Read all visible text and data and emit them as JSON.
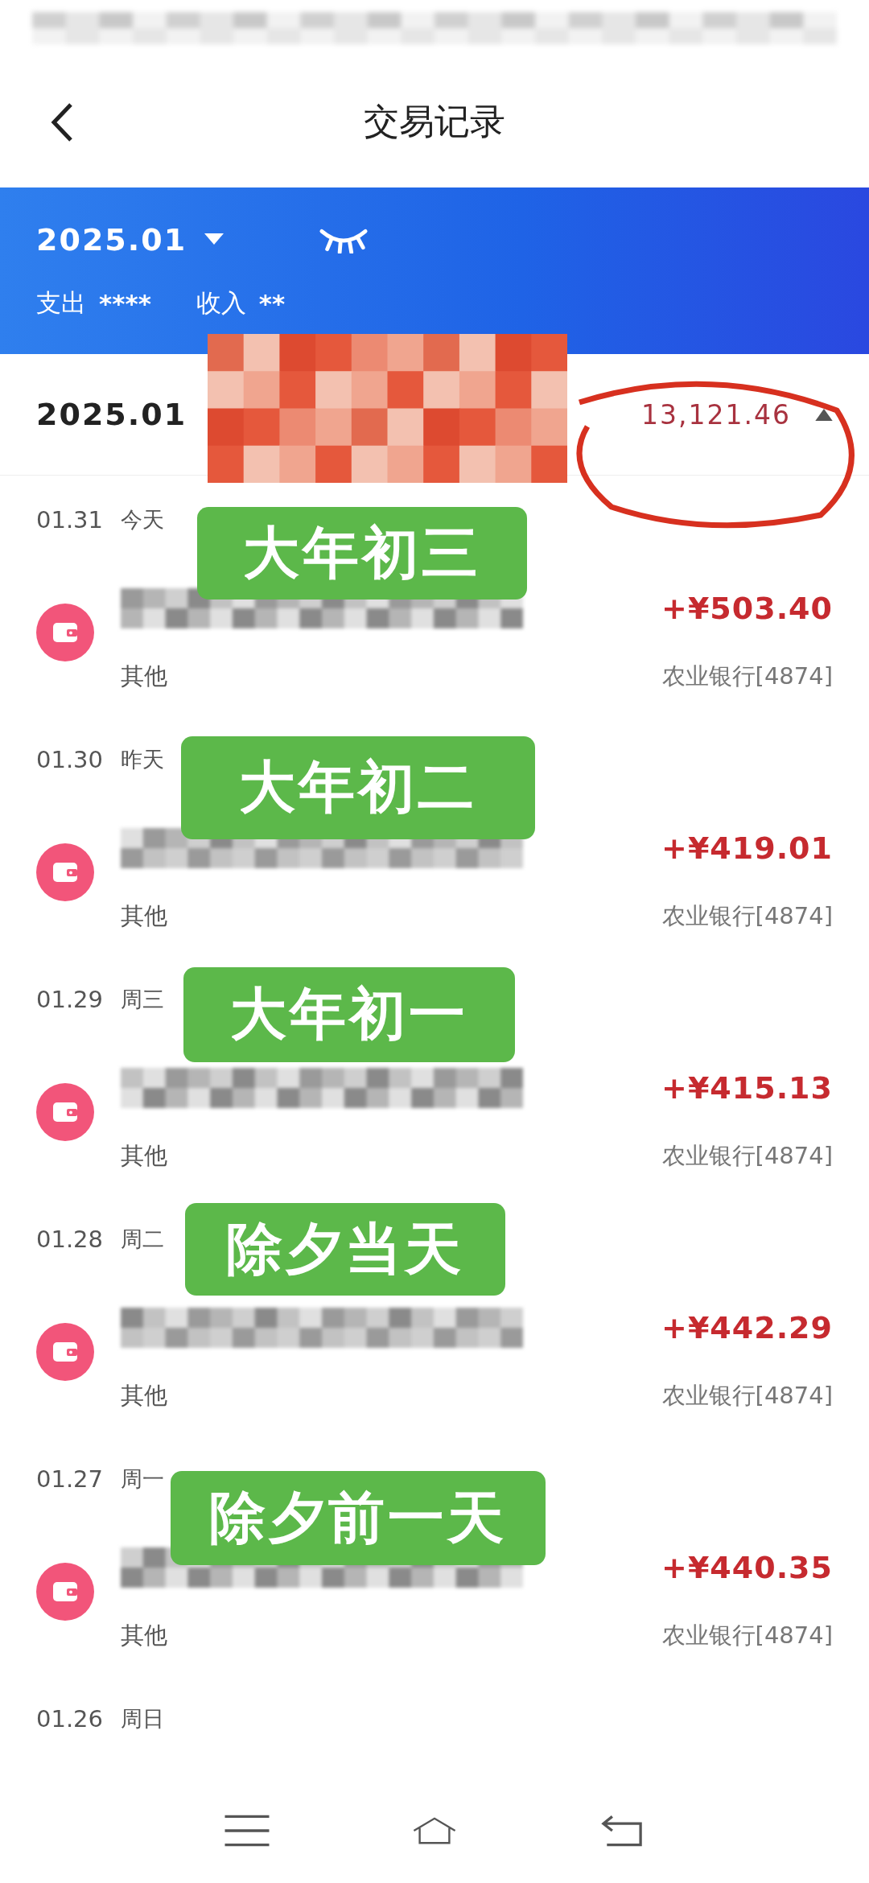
{
  "title": "交易记录",
  "banner": {
    "month": "2025.01",
    "expense_label": "支出",
    "expense": "****",
    "income_label": "收入",
    "income": "**"
  },
  "month_summary": {
    "month": "2025.01",
    "amount": "13,121.46",
    "expanded": true
  },
  "days": [
    {
      "date": "01.31",
      "weekday": "今天",
      "sticker": "大年初三",
      "transactions": [
        {
          "amount": "+¥503.40",
          "category": "其他",
          "account": "农业银行[4874]"
        }
      ]
    },
    {
      "date": "01.30",
      "weekday": "昨天",
      "sticker": "大年初二",
      "transactions": [
        {
          "amount": "+¥419.01",
          "category": "其他",
          "account": "农业银行[4874]"
        }
      ]
    },
    {
      "date": "01.29",
      "weekday": "周三",
      "sticker": "大年初一",
      "transactions": [
        {
          "amount": "+¥415.13",
          "category": "其他",
          "account": "农业银行[4874]"
        }
      ]
    },
    {
      "date": "01.28",
      "weekday": "周二",
      "sticker": "除夕当天",
      "transactions": [
        {
          "amount": "+¥442.29",
          "category": "其他",
          "account": "农业银行[4874]"
        }
      ]
    },
    {
      "date": "01.27",
      "weekday": "周一",
      "sticker": "除夕前一天",
      "transactions": [
        {
          "amount": "+¥440.35",
          "category": "其他",
          "account": "农业银行[4874]"
        }
      ]
    },
    {
      "date": "01.26",
      "weekday": "周日"
    }
  ]
}
